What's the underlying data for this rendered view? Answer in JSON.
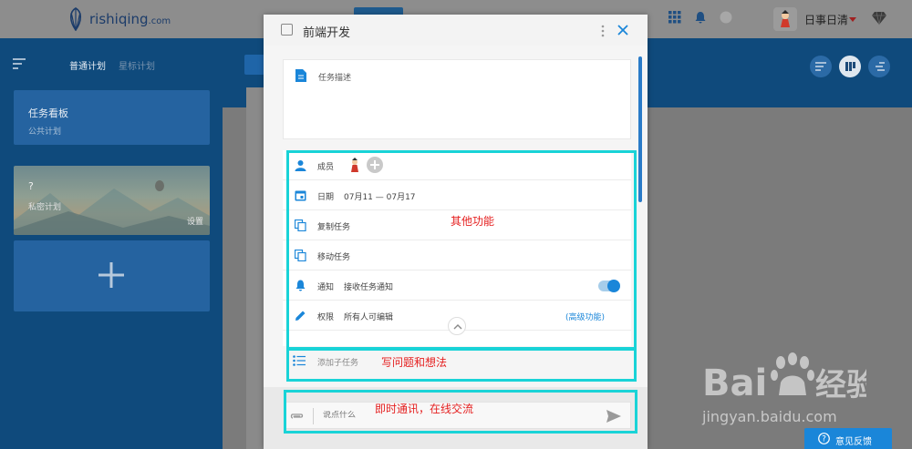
{
  "header": {
    "logo_text": "rishiqing",
    "logo_domain": ".com",
    "user_name": "日事日清"
  },
  "sidebar": {
    "tabs": [
      {
        "label": "普通计划",
        "active": true
      },
      {
        "label": "星标计划",
        "active": false
      }
    ],
    "cards": [
      {
        "title": "任务看板",
        "subtitle": "公共计划"
      },
      {
        "title": "?",
        "subtitle": "私密计划",
        "action": "设置"
      }
    ]
  },
  "modal": {
    "title": "前端开发",
    "description_label": "任务描述",
    "rows": [
      {
        "icon": "person-icon",
        "label": "成员"
      },
      {
        "icon": "calendar-icon",
        "label": "日期",
        "value": "07月11 — 07月17"
      },
      {
        "icon": "copy-icon",
        "label": "复制任务"
      },
      {
        "icon": "move-icon",
        "label": "移动任务"
      },
      {
        "icon": "bell-icon",
        "label": "通知",
        "value": "接收任务通知",
        "toggle": true
      },
      {
        "icon": "pencil-icon",
        "label": "权限",
        "value": "所有人可编辑",
        "link": "(高级功能)"
      }
    ],
    "subtask_placeholder": "添加子任务",
    "chat_placeholder": "说点什么"
  },
  "annotations": {
    "other_features": "其他功能",
    "questions": "写问题和想法",
    "im": "即时通讯，在线交流"
  },
  "watermark": {
    "domain": "jingyan.baidu.com"
  },
  "feedback": {
    "label": "意见反馈"
  },
  "colors": {
    "accent": "#1a86d9",
    "annotation_border": "#19d3d7",
    "annotation_text": "#e52020",
    "sidebar_bg": "#0f4a7c"
  }
}
